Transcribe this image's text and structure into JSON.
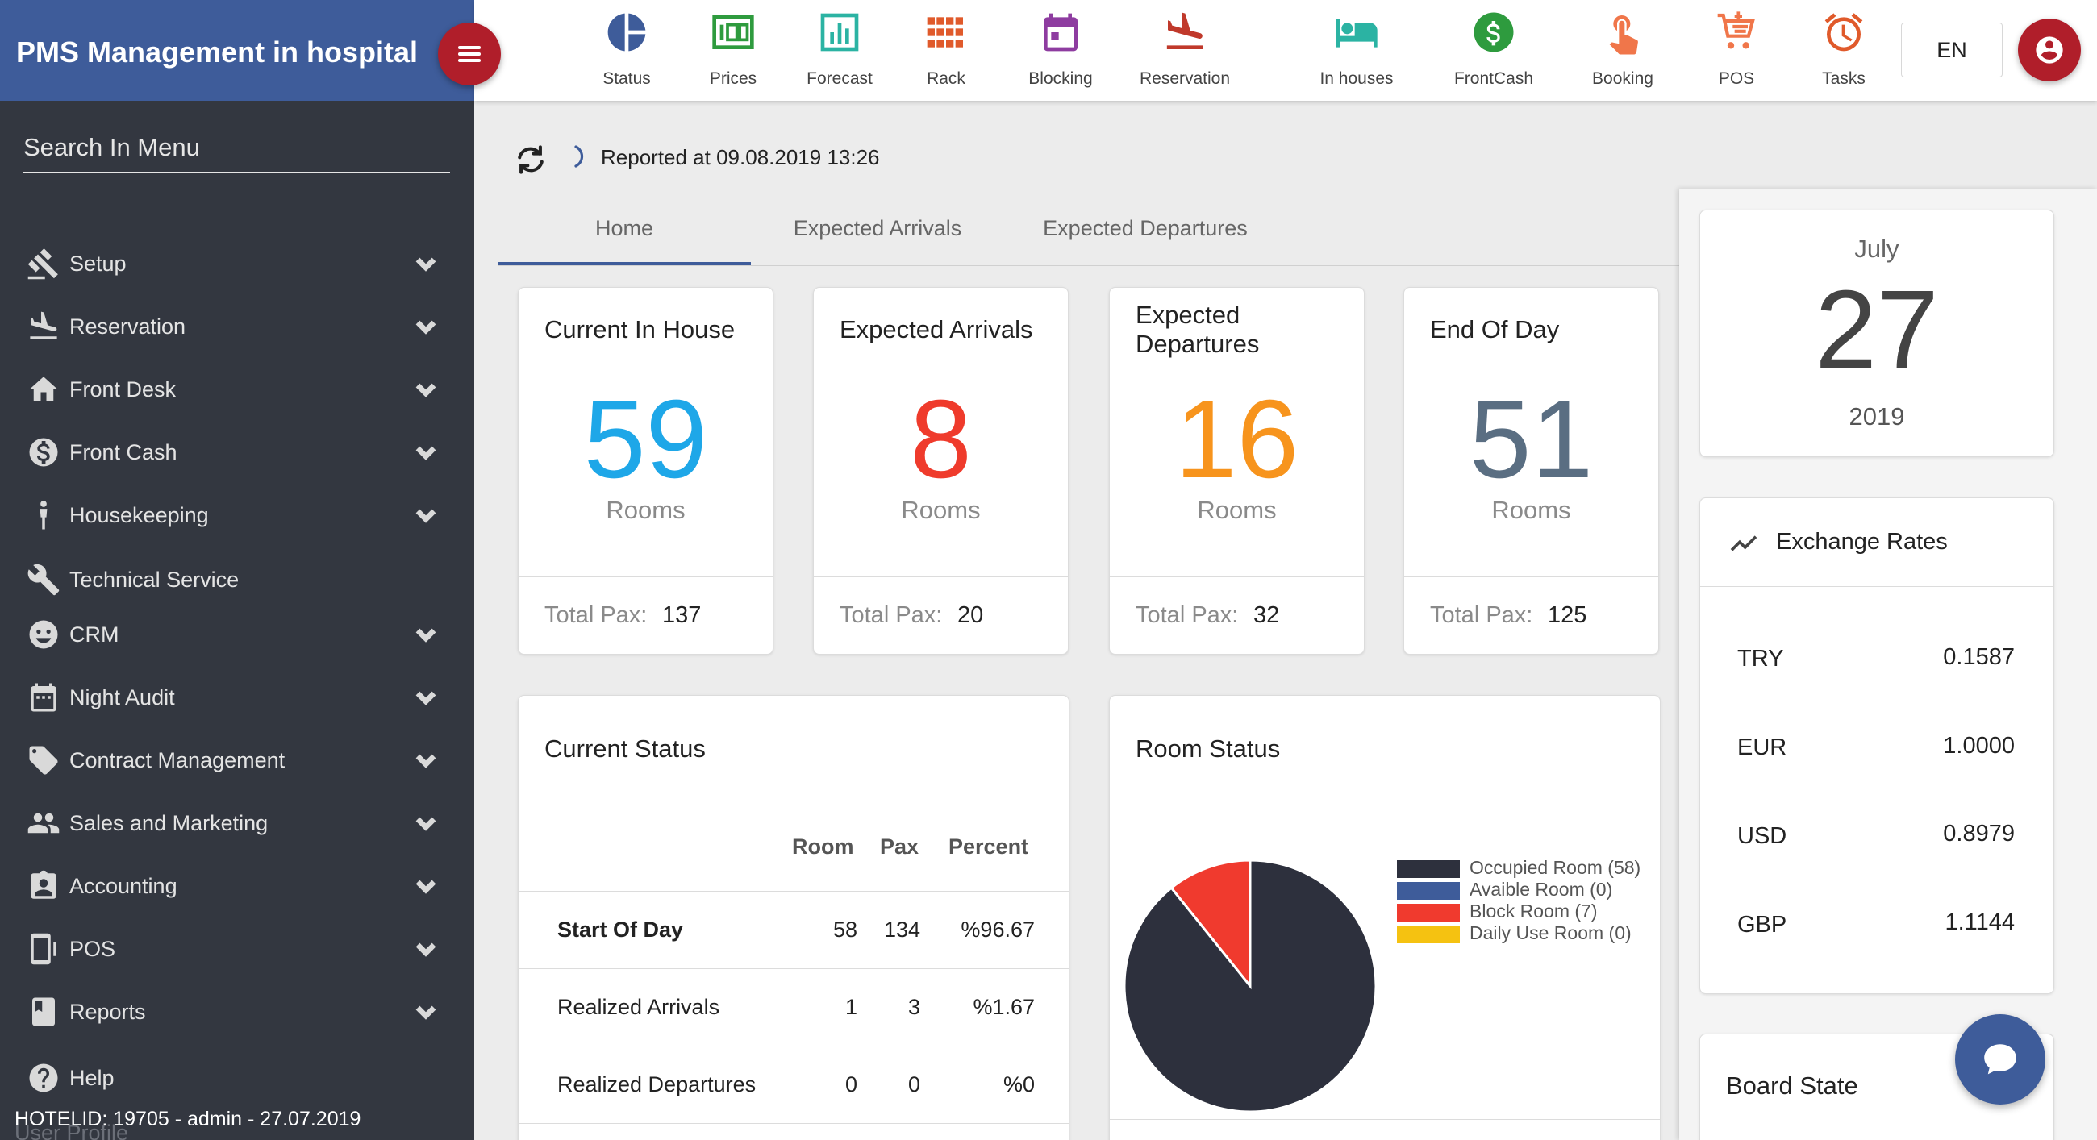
{
  "app": {
    "title": "PMS Management in hospital"
  },
  "sidebar": {
    "search_placeholder": "Search In Menu",
    "items": [
      {
        "label": "Setup",
        "icon": "gavel-icon",
        "expandable": true
      },
      {
        "label": "Reservation",
        "icon": "plane-landing-icon",
        "expandable": true
      },
      {
        "label": "Front Desk",
        "icon": "home-icon",
        "expandable": true
      },
      {
        "label": "Front Cash",
        "icon": "dollar-icon",
        "expandable": true
      },
      {
        "label": "Housekeeping",
        "icon": "person-icon",
        "expandable": true
      },
      {
        "label": "Technical Service",
        "icon": "wrench-icon",
        "expandable": false
      },
      {
        "label": "CRM",
        "icon": "face-icon",
        "expandable": true
      },
      {
        "label": "Night Audit",
        "icon": "calendar-icon",
        "expandable": true
      },
      {
        "label": "Contract Management",
        "icon": "tag-icon",
        "expandable": true
      },
      {
        "label": "Sales and Marketing",
        "icon": "people-icon",
        "expandable": true
      },
      {
        "label": "Accounting",
        "icon": "id-card-icon",
        "expandable": true
      },
      {
        "label": "POS",
        "icon": "tablet-icon",
        "expandable": true
      },
      {
        "label": "Reports",
        "icon": "book-icon",
        "expandable": true
      },
      {
        "label": "Help",
        "icon": "help-icon",
        "expandable": false
      }
    ],
    "ghost_item": "User Profile",
    "hotel_info": "HOTELID: 19705 - admin - 27.07.2019"
  },
  "toolbar": {
    "items": [
      {
        "label": "Status",
        "icon": "pie-chart-icon",
        "color": "#3e5c9a"
      },
      {
        "label": "Prices",
        "icon": "price-board-icon",
        "color": "#2e9b3e"
      },
      {
        "label": "Forecast",
        "icon": "bar-chart-icon",
        "color": "#2bb3a3"
      },
      {
        "label": "Rack",
        "icon": "grid-icon",
        "color": "#e05a2b"
      },
      {
        "label": "Blocking",
        "icon": "calendar-block-icon",
        "color": "#8e3ca0"
      },
      {
        "label": "Reservation",
        "icon": "plane-landing-icon",
        "color": "#c0392b"
      },
      {
        "label": "In houses",
        "icon": "hotel-bed-icon",
        "color": "#2bb3a3"
      },
      {
        "label": "FrontCash",
        "icon": "dollar-circle-icon",
        "color": "#2e9b3e"
      },
      {
        "label": "Booking",
        "icon": "touch-icon",
        "color": "#f0764a"
      },
      {
        "label": "POS",
        "icon": "cart-icon",
        "color": "#f0764a"
      },
      {
        "label": "Tasks",
        "icon": "alarm-icon",
        "color": "#e05a2b"
      }
    ],
    "language": "EN"
  },
  "report": {
    "text": "Reported at 09.08.2019 13:26"
  },
  "tabs": [
    {
      "label": "Home",
      "active": true
    },
    {
      "label": "Expected Arrivals",
      "active": false
    },
    {
      "label": "Expected Departures",
      "active": false
    }
  ],
  "kpis": [
    {
      "title": "Current In House",
      "value": "59",
      "unit": "Rooms",
      "pax_label": "Total Pax:",
      "pax": "137",
      "color": "#1ea7e8"
    },
    {
      "title": "Expected Arrivals",
      "value": "8",
      "unit": "Rooms",
      "pax_label": "Total Pax:",
      "pax": "20",
      "color": "#ef3b2c"
    },
    {
      "title": "Expected Departures",
      "value": "16",
      "unit": "Rooms",
      "pax_label": "Total Pax:",
      "pax": "32",
      "color": "#f7941d"
    },
    {
      "title": "End Of Day",
      "value": "51",
      "unit": "Rooms",
      "pax_label": "Total Pax:",
      "pax": "125",
      "color": "#5a6e82"
    }
  ],
  "current_status": {
    "title": "Current Status",
    "headers": [
      "Room",
      "Pax",
      "Percent"
    ],
    "rows": [
      {
        "label": "Start Of Day",
        "room": "58",
        "pax": "134",
        "percent": "%96.67",
        "bold": true
      },
      {
        "label": "Realized Arrivals",
        "room": "1",
        "pax": "3",
        "percent": "%1.67",
        "bold": false
      },
      {
        "label": "Realized Departures",
        "room": "0",
        "pax": "0",
        "percent": "%0",
        "bold": false
      }
    ]
  },
  "room_status": {
    "title": "Room Status",
    "legend": [
      {
        "label": "Occupied Room (58)",
        "color": "#2d303d"
      },
      {
        "label": "Avaible Room (0)",
        "color": "#3e5c9a"
      },
      {
        "label": "Block Room (7)",
        "color": "#f03a2e"
      },
      {
        "label": "Daily Use Room (0)",
        "color": "#f5c211"
      }
    ]
  },
  "chart_data": {
    "type": "pie",
    "categories": [
      "Occupied Room",
      "Avaible Room",
      "Block Room",
      "Daily Use Room"
    ],
    "values": [
      58,
      0,
      7,
      0
    ],
    "colors": [
      "#2d303d",
      "#3e5c9a",
      "#f03a2e",
      "#f5c211"
    ],
    "legend_position": "right"
  },
  "date_card": {
    "month": "July",
    "day": "27",
    "year": "2019"
  },
  "exchange": {
    "title": "Exchange Rates",
    "rates": [
      {
        "code": "TRY",
        "value": "0.1587"
      },
      {
        "code": "EUR",
        "value": "1.0000"
      },
      {
        "code": "USD",
        "value": "0.8979"
      },
      {
        "code": "GBP",
        "value": "1.1144"
      }
    ]
  },
  "board_state": {
    "title": "Board State"
  }
}
